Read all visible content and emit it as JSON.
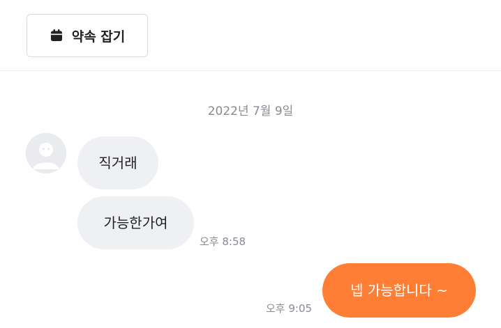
{
  "header": {
    "appointment_button_label": "약속 잡기",
    "icon": "calendar-icon"
  },
  "chat": {
    "date_divider": "2022년 7월 9일",
    "messages": [
      {
        "sender": "other",
        "text": "직거래"
      },
      {
        "sender": "other",
        "text": "가능한가여",
        "time": "오후 8:58"
      },
      {
        "sender": "me",
        "text": "넵 가능합니다 ~",
        "time": "오후 9:05"
      }
    ]
  },
  "colors": {
    "accent": "#ff7e36",
    "incoming_bubble": "#eef0f3",
    "muted_text": "#868b94",
    "primary_text": "#212124"
  }
}
